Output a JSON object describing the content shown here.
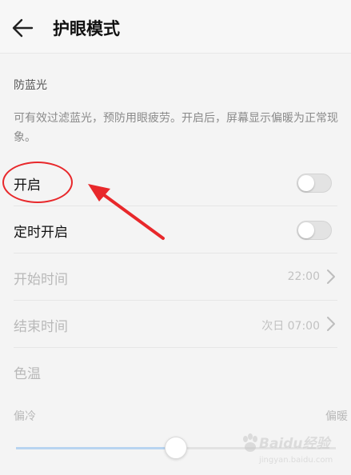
{
  "header": {
    "title": "护眼模式"
  },
  "section": {
    "title": "防蓝光",
    "description": "可有效过滤蓝光，预防用眼疲劳。开启后，屏幕显示偏暖为正常现象。"
  },
  "rows": {
    "enable": {
      "label": "开启",
      "on": false
    },
    "schedule": {
      "label": "定时开启",
      "on": false
    },
    "start": {
      "label": "开始时间",
      "value": "22:00"
    },
    "end": {
      "label": "结束时间",
      "value": "次日 07:00"
    },
    "color_temp": {
      "label": "色温"
    }
  },
  "slider": {
    "left_label": "偏冷",
    "right_label": "偏暖",
    "value": 0.5
  },
  "watermark": {
    "text": "Baidu经验",
    "sub": "jingyan.baidu.com"
  },
  "colors": {
    "annotation": "#e8282b",
    "slider_fill": "#b8d4f0",
    "toggle_off": "#e3e3e3"
  }
}
